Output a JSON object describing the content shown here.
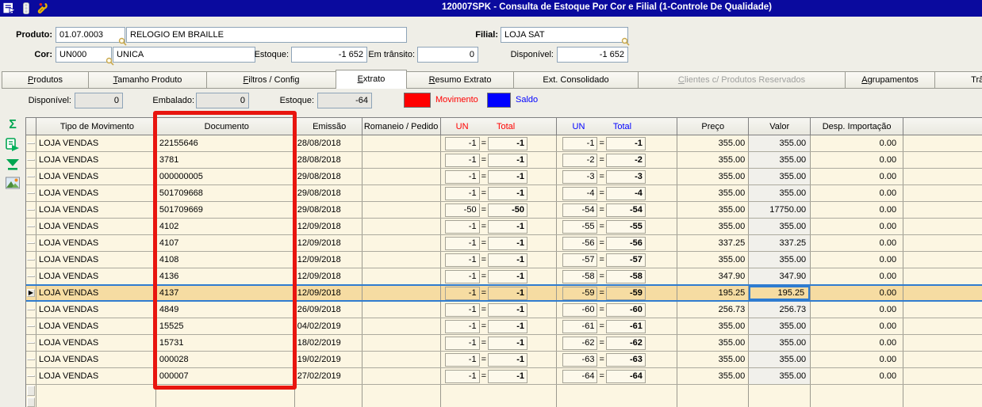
{
  "title_bar": {
    "title": "120007SPK - Consulta de Estoque Por Cor e Filial (1-Controle De Qualidade)",
    "color": "#0A0A9E",
    "icons": [
      "export-form-icon",
      "traffic-light-icon",
      "wrench-icon"
    ]
  },
  "form": {
    "produto_label": "Produto:",
    "produto_code": "01.07.0003",
    "produto_desc": "RELOGIO EM BRAILLE",
    "filial_label": "Filial:",
    "filial_value": "LOJA SAT",
    "cor_label": "Cor:",
    "cor_code": "UN000",
    "cor_desc": "UNICA",
    "estoque_label": "Estoque:",
    "estoque_value": "-1 652",
    "transito_label": "Em trânsito:",
    "transito_value": "0",
    "disponivel_label": "Disponível:",
    "disponivel_value": "-1 652"
  },
  "tabs": [
    {
      "id": "produtos",
      "label": "Produtos",
      "accel": 0
    },
    {
      "id": "tamanho-produto",
      "label": "Tamanho Produto",
      "accel": 0
    },
    {
      "id": "filtros-config",
      "label": "Filtros / Config",
      "accel": 0
    },
    {
      "id": "extrato",
      "label": "Extrato",
      "accel": 0,
      "active": true
    },
    {
      "id": "resumo-extrato",
      "label": "Resumo Extrato",
      "accel": 0
    },
    {
      "id": "ext-consolidado",
      "label": "Ext. Consolidado",
      "accel": -1
    },
    {
      "id": "clientes-produtos-reservados",
      "label": "Clientes c/ Produtos Reservados",
      "accel": 0,
      "disabled": true
    },
    {
      "id": "agrupamentos",
      "label": "Agrupamentos",
      "accel": 0
    },
    {
      "id": "transito",
      "label": "Trâns",
      "accel": -1
    }
  ],
  "summary": {
    "disponivel_label": "Disponível:",
    "disponivel_value": "0",
    "embalado_label": "Embalado:",
    "embalado_value": "0",
    "estoque_label": "Estoque:",
    "estoque_value": "-64",
    "legend": [
      {
        "label": "Movimento",
        "color": "#FF0000"
      },
      {
        "label": "Saldo",
        "color": "#0000FF"
      }
    ]
  },
  "toolbar": {
    "icons": [
      "sum-icon",
      "export-grid-icon",
      "filter-icon",
      "image-icon"
    ]
  },
  "grid": {
    "equals_sign": "=",
    "row_arrow": "▶",
    "movement_color": "#FF0000",
    "saldo_color": "#0000FF",
    "selection_color": "#F6DCA2",
    "annotation_color": "#E8150F",
    "headers": {
      "tipo": "Tipo de Movimento",
      "documento": "Documento",
      "emissao": "Emissão",
      "romaneio": "Romaneio / Pedido",
      "un": "UN",
      "total": "Total",
      "preco": "Preço",
      "valor": "Valor",
      "desp": "Desp. Importação"
    },
    "rows": [
      {
        "tipo": "LOJA VENDAS",
        "documento": "22155646",
        "emissao": "28/08/2018",
        "romaneio": "",
        "mov_un": "-1",
        "mov_total": "-1",
        "saldo_un": "-1",
        "saldo_total": "-1",
        "preco": "355.00",
        "valor": "355.00",
        "desp": "0.00",
        "selected": false
      },
      {
        "tipo": "LOJA VENDAS",
        "documento": "3781",
        "emissao": "28/08/2018",
        "romaneio": "",
        "mov_un": "-1",
        "mov_total": "-1",
        "saldo_un": "-2",
        "saldo_total": "-2",
        "preco": "355.00",
        "valor": "355.00",
        "desp": "0.00",
        "selected": false
      },
      {
        "tipo": "LOJA VENDAS",
        "documento": "000000005",
        "emissao": "29/08/2018",
        "romaneio": "",
        "mov_un": "-1",
        "mov_total": "-1",
        "saldo_un": "-3",
        "saldo_total": "-3",
        "preco": "355.00",
        "valor": "355.00",
        "desp": "0.00",
        "selected": false
      },
      {
        "tipo": "LOJA VENDAS",
        "documento": "501709668",
        "emissao": "29/08/2018",
        "romaneio": "",
        "mov_un": "-1",
        "mov_total": "-1",
        "saldo_un": "-4",
        "saldo_total": "-4",
        "preco": "355.00",
        "valor": "355.00",
        "desp": "0.00",
        "selected": false
      },
      {
        "tipo": "LOJA VENDAS",
        "documento": "501709669",
        "emissao": "29/08/2018",
        "romaneio": "",
        "mov_un": "-50",
        "mov_total": "-50",
        "saldo_un": "-54",
        "saldo_total": "-54",
        "preco": "355.00",
        "valor": "17750.00",
        "desp": "0.00",
        "selected": false
      },
      {
        "tipo": "LOJA VENDAS",
        "documento": "4102",
        "emissao": "12/09/2018",
        "romaneio": "",
        "mov_un": "-1",
        "mov_total": "-1",
        "saldo_un": "-55",
        "saldo_total": "-55",
        "preco": "355.00",
        "valor": "355.00",
        "desp": "0.00",
        "selected": false
      },
      {
        "tipo": "LOJA VENDAS",
        "documento": "4107",
        "emissao": "12/09/2018",
        "romaneio": "",
        "mov_un": "-1",
        "mov_total": "-1",
        "saldo_un": "-56",
        "saldo_total": "-56",
        "preco": "337.25",
        "valor": "337.25",
        "desp": "0.00",
        "selected": false
      },
      {
        "tipo": "LOJA VENDAS",
        "documento": "4108",
        "emissao": "12/09/2018",
        "romaneio": "",
        "mov_un": "-1",
        "mov_total": "-1",
        "saldo_un": "-57",
        "saldo_total": "-57",
        "preco": "355.00",
        "valor": "355.00",
        "desp": "0.00",
        "selected": false
      },
      {
        "tipo": "LOJA VENDAS",
        "documento": "4136",
        "emissao": "12/09/2018",
        "romaneio": "",
        "mov_un": "-1",
        "mov_total": "-1",
        "saldo_un": "-58",
        "saldo_total": "-58",
        "preco": "347.90",
        "valor": "347.90",
        "desp": "0.00",
        "selected": false
      },
      {
        "tipo": "LOJA VENDAS",
        "documento": "4137",
        "emissao": "12/09/2018",
        "romaneio": "",
        "mov_un": "-1",
        "mov_total": "-1",
        "saldo_un": "-59",
        "saldo_total": "-59",
        "preco": "195.25",
        "valor": "195.25",
        "desp": "0.00",
        "selected": true
      },
      {
        "tipo": "LOJA VENDAS",
        "documento": "4849",
        "emissao": "26/09/2018",
        "romaneio": "",
        "mov_un": "-1",
        "mov_total": "-1",
        "saldo_un": "-60",
        "saldo_total": "-60",
        "preco": "256.73",
        "valor": "256.73",
        "desp": "0.00",
        "selected": false
      },
      {
        "tipo": "LOJA VENDAS",
        "documento": "15525",
        "emissao": "04/02/2019",
        "romaneio": "",
        "mov_un": "-1",
        "mov_total": "-1",
        "saldo_un": "-61",
        "saldo_total": "-61",
        "preco": "355.00",
        "valor": "355.00",
        "desp": "0.00",
        "selected": false
      },
      {
        "tipo": "LOJA VENDAS",
        "documento": "15731",
        "emissao": "18/02/2019",
        "romaneio": "",
        "mov_un": "-1",
        "mov_total": "-1",
        "saldo_un": "-62",
        "saldo_total": "-62",
        "preco": "355.00",
        "valor": "355.00",
        "desp": "0.00",
        "selected": false
      },
      {
        "tipo": "LOJA VENDAS",
        "documento": "000028",
        "emissao": "19/02/2019",
        "romaneio": "",
        "mov_un": "-1",
        "mov_total": "-1",
        "saldo_un": "-63",
        "saldo_total": "-63",
        "preco": "355.00",
        "valor": "355.00",
        "desp": "0.00",
        "selected": false
      },
      {
        "tipo": "LOJA VENDAS",
        "documento": "000007",
        "emissao": "27/02/2019",
        "romaneio": "",
        "mov_un": "-1",
        "mov_total": "-1",
        "saldo_un": "-64",
        "saldo_total": "-64",
        "preco": "355.00",
        "valor": "355.00",
        "desp": "0.00",
        "selected": false
      }
    ]
  }
}
